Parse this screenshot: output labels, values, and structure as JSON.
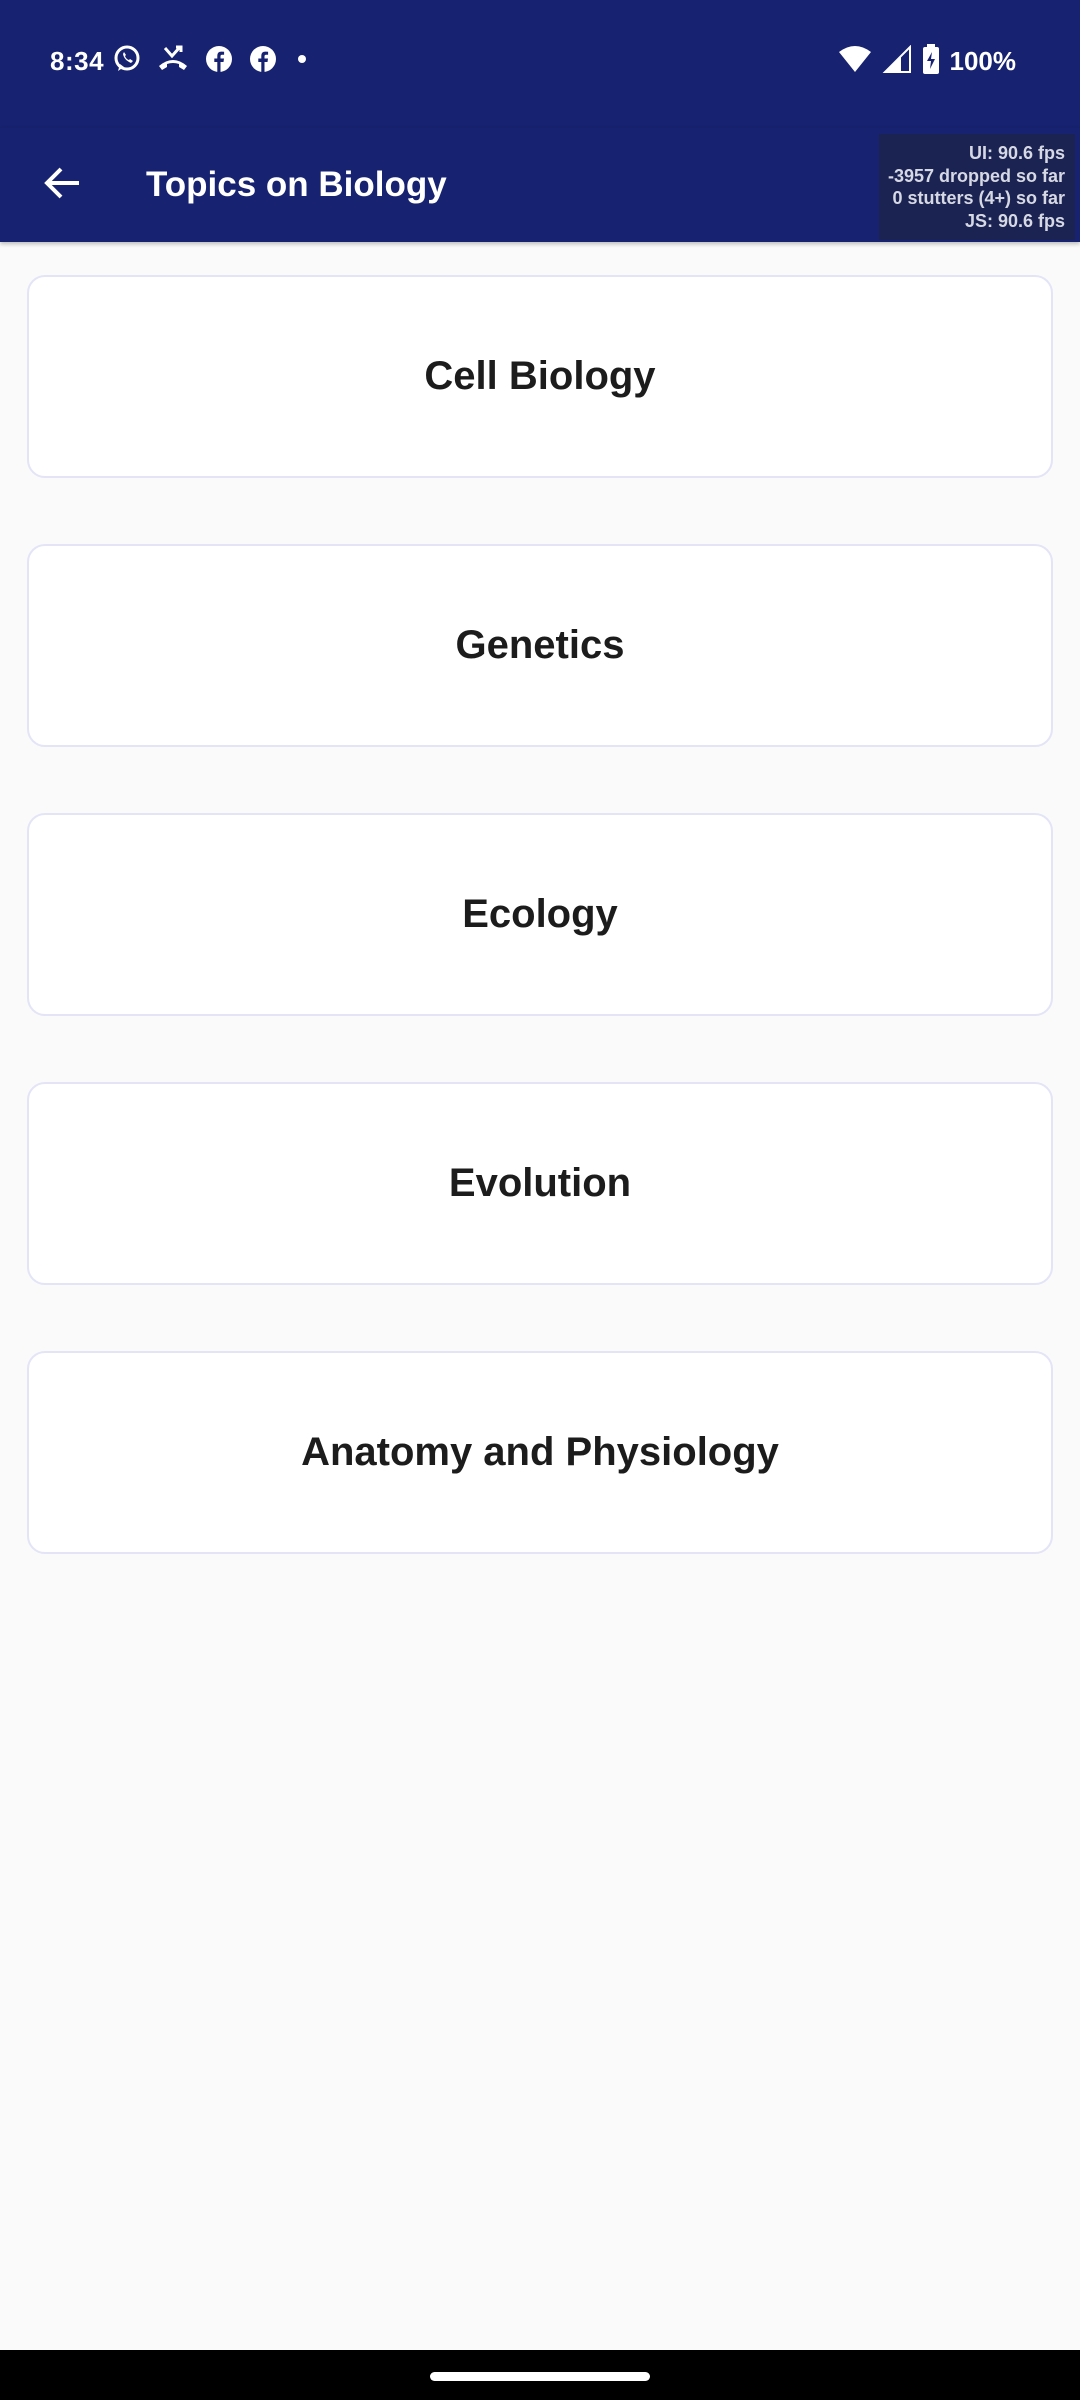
{
  "status_bar": {
    "time": "8:34",
    "notification_icons": [
      "whatsapp-icon",
      "missed-call-icon",
      "facebook-icon",
      "facebook-icon",
      "dot-icon"
    ],
    "battery_percent": "100%",
    "background_color": "#172270"
  },
  "app_bar": {
    "title": "Topics on Biology",
    "back_icon": "arrow-left-icon",
    "background_color": "#172270"
  },
  "perf_overlay": {
    "ui_fps": "UI: 90.6 fps",
    "dropped": "-3957 dropped so far",
    "stutters": "0 stutters (4+) so far",
    "js_fps": "JS: 90.6 fps"
  },
  "topics": [
    {
      "label": "Cell Biology"
    },
    {
      "label": "Genetics"
    },
    {
      "label": "Ecology"
    },
    {
      "label": "Evolution"
    },
    {
      "label": "Anatomy and Physiology"
    }
  ]
}
